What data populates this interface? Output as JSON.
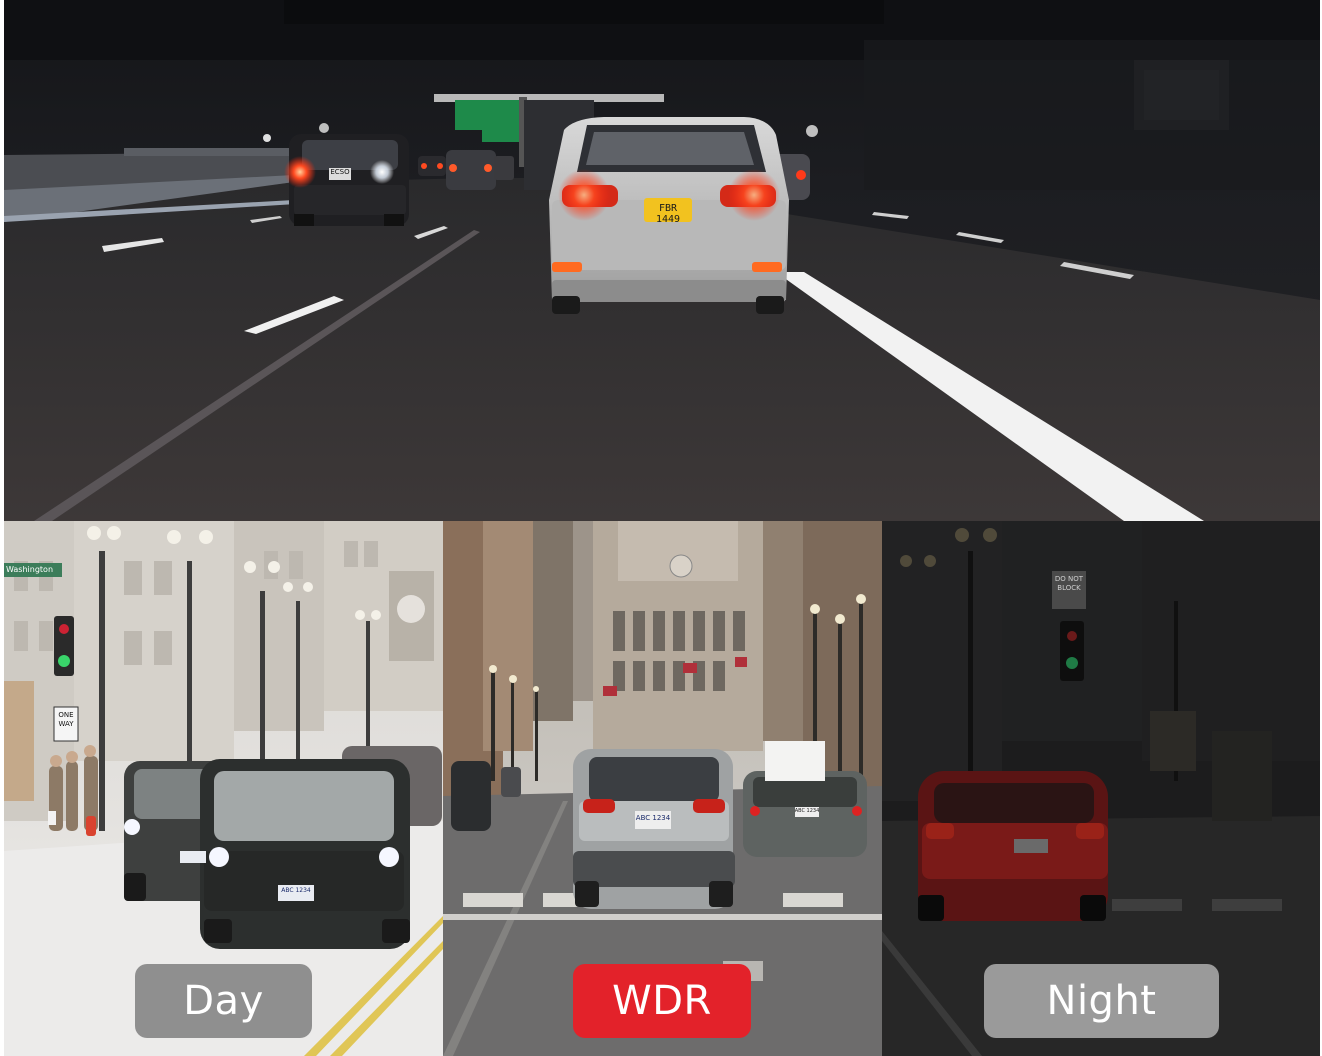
{
  "colors": {
    "wdr_accent": "#e3222a",
    "badge_gray": "#8f8f8f",
    "badge_gray_night": "#9a9a9a",
    "badge_text": "#ffffff"
  },
  "top_scene": {
    "front_plate": "FBR 1449",
    "left_plate": "ECSO"
  },
  "bottom_scene": {
    "street_sign": "Washington",
    "one_way_sign": "ONE WAY",
    "no_block_sign": "DO NOT BLOCK",
    "wdr_plate": "ABC 1234",
    "day_plate": "ABC 1234",
    "right_plate": "ABC 1234"
  },
  "modes": [
    {
      "label": "Day",
      "selected": false
    },
    {
      "label": "WDR",
      "selected": true
    },
    {
      "label": "Night",
      "selected": false
    }
  ]
}
